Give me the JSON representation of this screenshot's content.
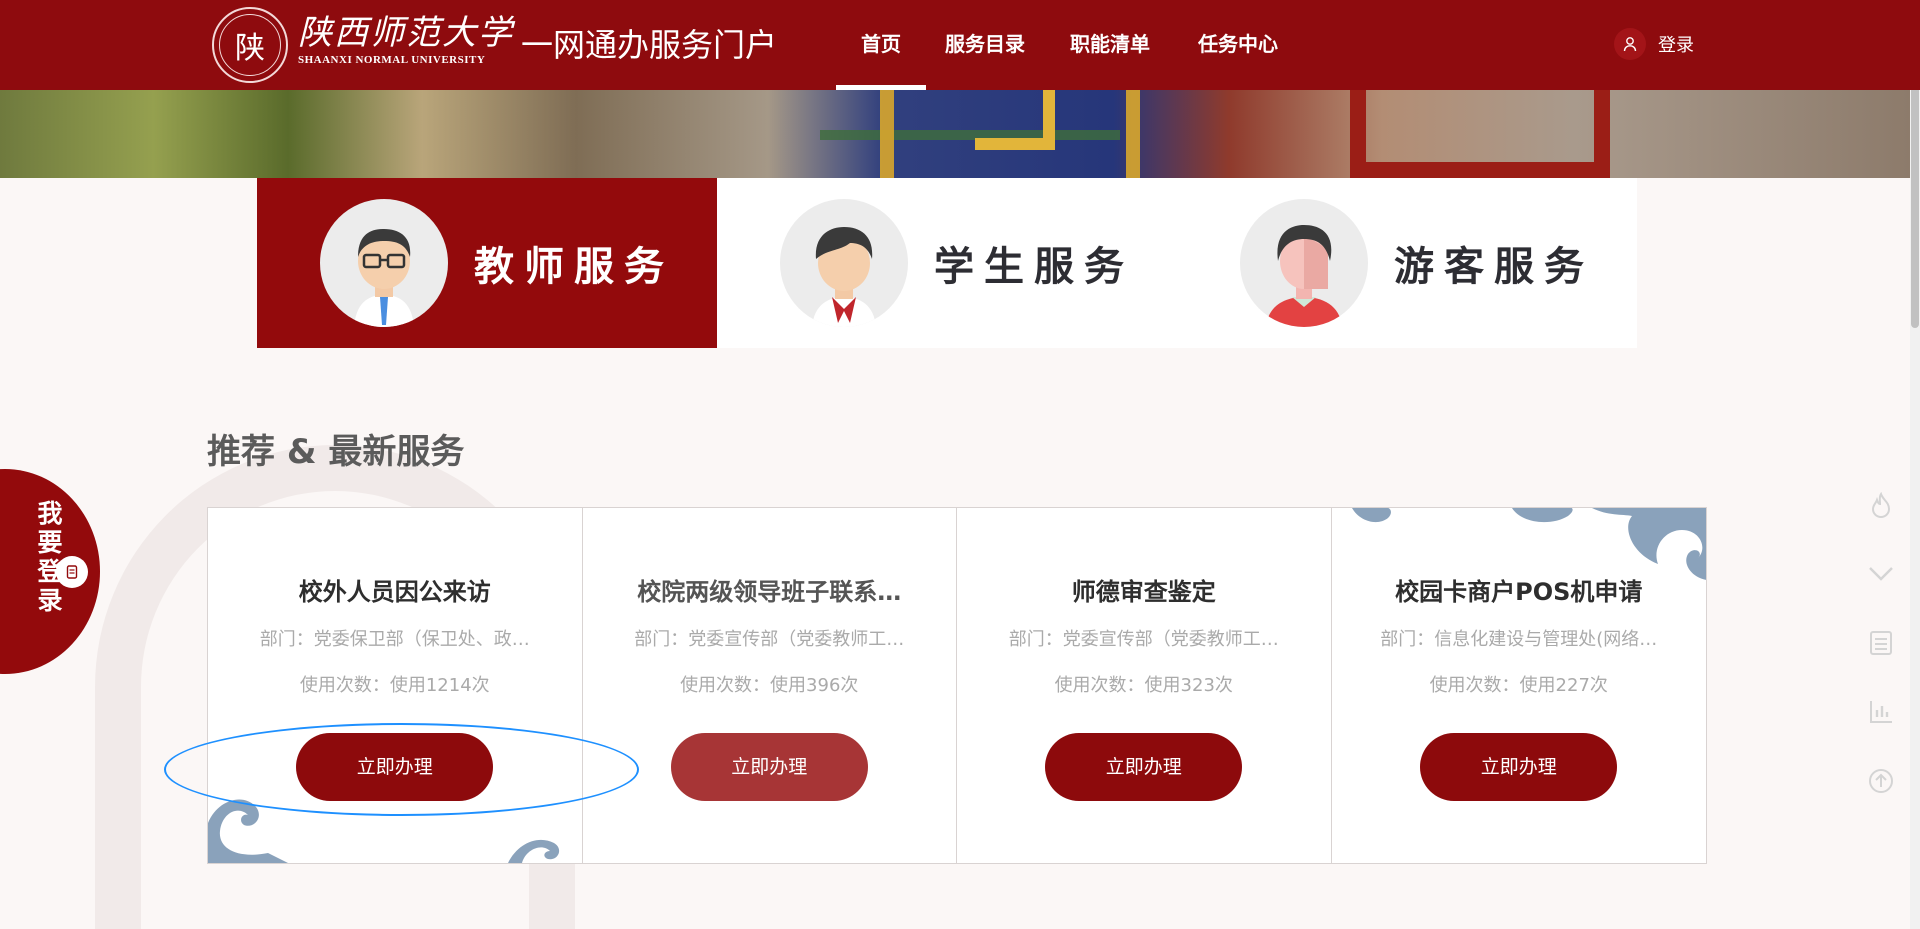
{
  "header": {
    "logo_seal_char": "陕",
    "university_cn": "陕西师范大学",
    "university_en": "SHAANXI NORMAL UNIVERSITY",
    "portal_title": "一网通办服务门户",
    "nav": [
      {
        "label": "首页",
        "active": true
      },
      {
        "label": "服务目录",
        "active": false
      },
      {
        "label": "职能清单",
        "active": false
      },
      {
        "label": "任务中心",
        "active": false
      }
    ],
    "login_label": "登录"
  },
  "service_tabs": [
    {
      "label": "教师服务",
      "active": true
    },
    {
      "label": "学生服务",
      "active": false
    },
    {
      "label": "游客服务",
      "active": false
    }
  ],
  "section_title": "推荐 & 最新服务",
  "cards": [
    {
      "title": "校外人员因公来访",
      "dept": "部门：党委保卫部（保卫处、政…",
      "usage": "使用次数：使用1214次",
      "button": "立即办理"
    },
    {
      "title": "校院两级领导班子联系…",
      "dept": "部门：党委宣传部（党委教师工…",
      "usage": "使用次数：使用396次",
      "button": "立即办理"
    },
    {
      "title": "师德审查鉴定",
      "dept": "部门：党委宣传部（党委教师工…",
      "usage": "使用次数：使用323次",
      "button": "立即办理"
    },
    {
      "title": "校园卡商户POS机申请",
      "dept": "部门：信息化建设与管理处(网络…",
      "usage": "使用次数：使用227次",
      "button": "立即办理"
    }
  ],
  "float_login": {
    "label": "我要登录"
  },
  "right_tools": [
    "fire-icon",
    "chevron-down-icon",
    "list-icon",
    "chart-icon",
    "arrow-up-icon"
  ],
  "colors": {
    "brand": "#8e0b0e",
    "button": "#8d0a0c",
    "highlight": "#1e90ff"
  }
}
